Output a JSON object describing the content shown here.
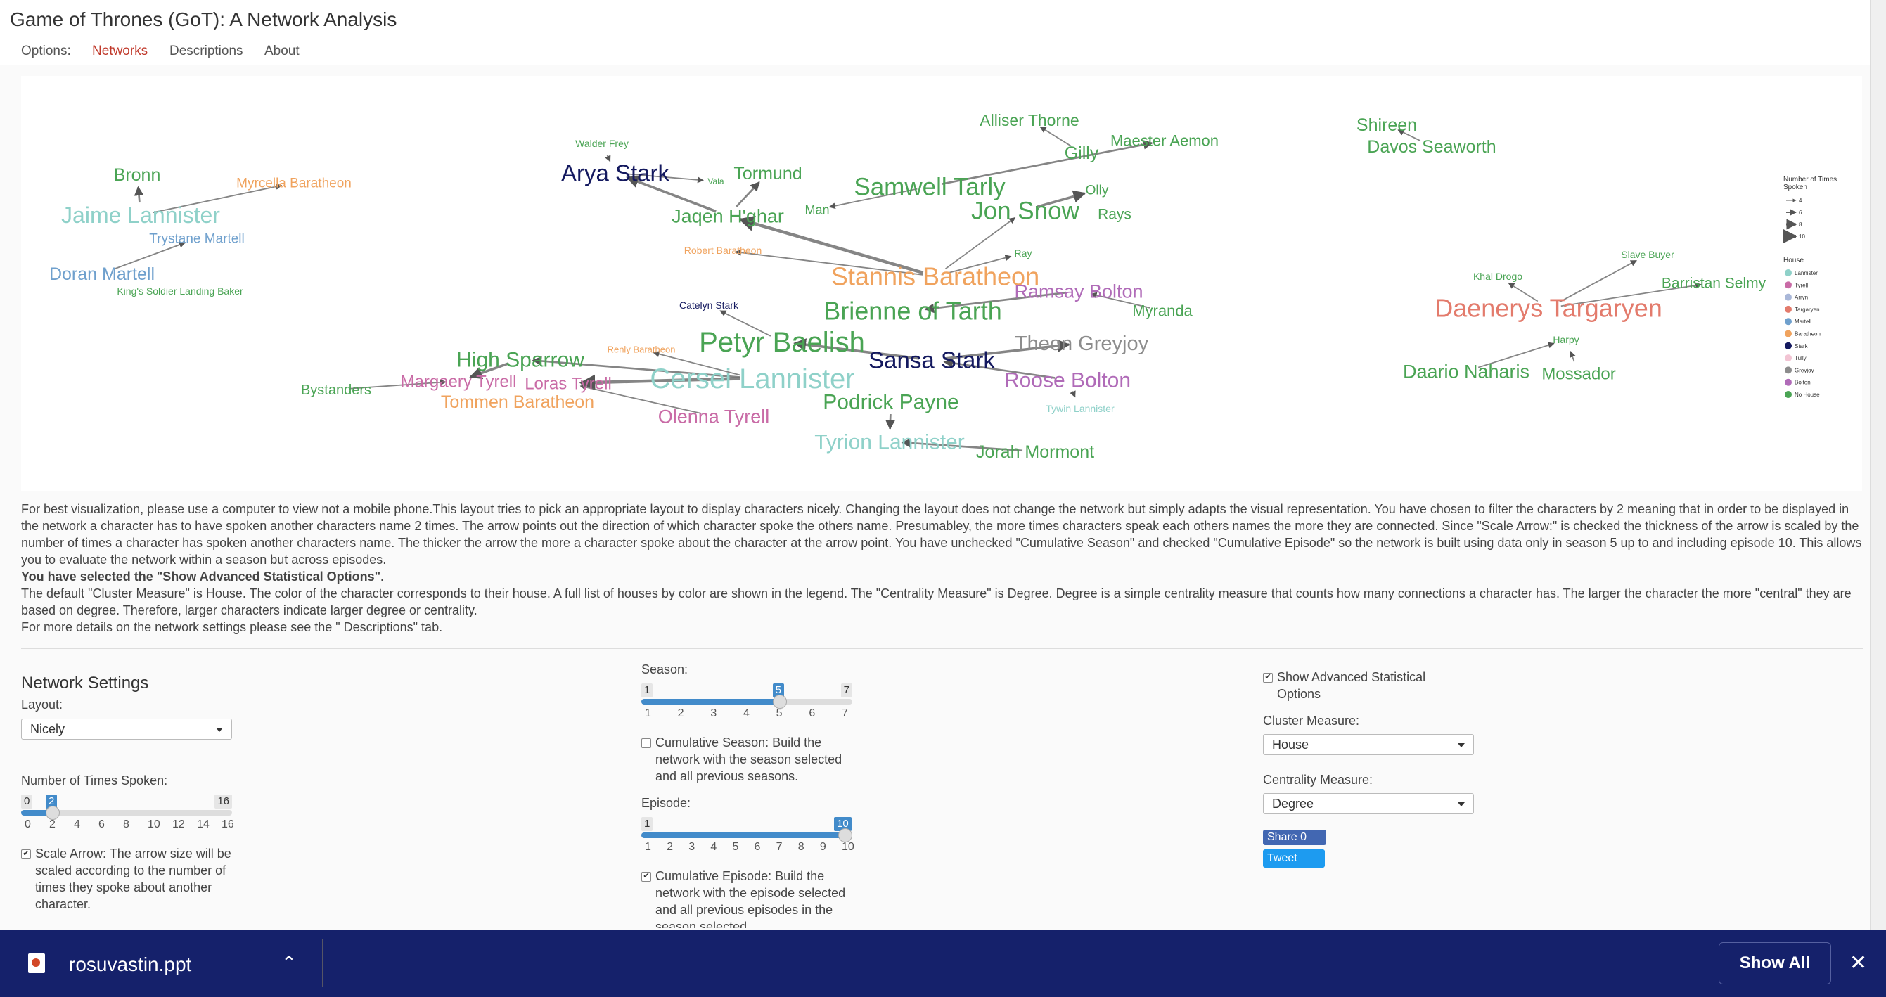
{
  "app_title": "Game of Thrones (GoT): A Network Analysis",
  "nav": {
    "options": "Options:",
    "networks": "Networks",
    "descriptions": "Descriptions",
    "about": "About"
  },
  "colors": {
    "active_nav": "#c0392b",
    "slider": "#428bca",
    "download_bar": "#15216b"
  },
  "network": {
    "legend": {
      "size_title_1": "Number of Times",
      "size_title_2": "Spoken",
      "sizes": [
        "4",
        "6",
        "8",
        "10"
      ],
      "house_title": "House",
      "houses": [
        {
          "name": "Lannister",
          "color": "#8fd1c9"
        },
        {
          "name": "Tyrell",
          "color": "#c96ba6"
        },
        {
          "name": "Arryn",
          "color": "#a9b7d8"
        },
        {
          "name": "Targaryen",
          "color": "#e37b6c"
        },
        {
          "name": "Martell",
          "color": "#6fa0cd"
        },
        {
          "name": "Baratheon",
          "color": "#f0a35e"
        },
        {
          "name": "Stark",
          "color": "#14195f"
        },
        {
          "name": "Tully",
          "color": "#f2c4d3"
        },
        {
          "name": "Greyjoy",
          "color": "#8c8c8c"
        },
        {
          "name": "Bolton",
          "color": "#b06bb8"
        },
        {
          "name": "No House",
          "color": "#4aa454"
        }
      ]
    },
    "nodes": [
      {
        "name": "Bronn",
        "house": "No House",
        "size": 25
      },
      {
        "name": "Myrcella Baratheon",
        "house": "Baratheon",
        "size": 19
      },
      {
        "name": "Jaime Lannister",
        "house": "Lannister",
        "size": 32
      },
      {
        "name": "Trystane Martell",
        "house": "Martell",
        "size": 19
      },
      {
        "name": "Doran Martell",
        "house": "Martell",
        "size": 25
      },
      {
        "name": "King's Soldier Landing Baker",
        "house": "No House",
        "size": 14
      },
      {
        "name": "Walder Frey",
        "house": "No House",
        "size": 14
      },
      {
        "name": "Arya Stark",
        "house": "Stark",
        "size": 33
      },
      {
        "name": "Vala",
        "house": "No House",
        "size": 12
      },
      {
        "name": "Tormund",
        "house": "No House",
        "size": 25
      },
      {
        "name": "Jaqen H'ghar",
        "house": "No House",
        "size": 27
      },
      {
        "name": "Man",
        "house": "No House",
        "size": 18
      },
      {
        "name": "Samwell Tarly",
        "house": "No House",
        "size": 35
      },
      {
        "name": "Alliser Thorne",
        "house": "No House",
        "size": 23
      },
      {
        "name": "Gilly",
        "house": "No House",
        "size": 25
      },
      {
        "name": "Maester Aemon",
        "house": "No House",
        "size": 22
      },
      {
        "name": "Olly",
        "house": "No House",
        "size": 19
      },
      {
        "name": "Jon Snow",
        "house": "No House",
        "size": 35
      },
      {
        "name": "Rays",
        "house": "No House",
        "size": 21
      },
      {
        "name": "Robert Baratheon",
        "house": "Baratheon",
        "size": 14
      },
      {
        "name": "Ray",
        "house": "No House",
        "size": 14
      },
      {
        "name": "Stannis Baratheon",
        "house": "Baratheon",
        "size": 36
      },
      {
        "name": "Ramsay Bolton",
        "house": "Bolton",
        "size": 27
      },
      {
        "name": "Myranda",
        "house": "No House",
        "size": 22
      },
      {
        "name": "Catelyn Stark",
        "house": "Stark",
        "size": 14
      },
      {
        "name": "Brienne of Tarth",
        "house": "No House",
        "size": 36
      },
      {
        "name": "Theon Greyjoy",
        "house": "Greyjoy",
        "size": 29
      },
      {
        "name": "Renly Baratheon",
        "house": "Baratheon",
        "size": 13
      },
      {
        "name": "Petyr Baelish",
        "house": "No House",
        "size": 40
      },
      {
        "name": "High Sparrow",
        "house": "No House",
        "size": 30
      },
      {
        "name": "Sansa Stark",
        "house": "Stark",
        "size": 33
      },
      {
        "name": "Bystanders",
        "house": "No House",
        "size": 20
      },
      {
        "name": "Margaery Tyrell",
        "house": "Tyrell",
        "size": 24
      },
      {
        "name": "Loras Tyrell",
        "house": "Tyrell",
        "size": 24
      },
      {
        "name": "Cersei Lannister",
        "house": "Lannister",
        "size": 40
      },
      {
        "name": "Roose Bolton",
        "house": "Bolton",
        "size": 30
      },
      {
        "name": "Tommen Baratheon",
        "house": "Baratheon",
        "size": 25
      },
      {
        "name": "Podrick Payne",
        "house": "No House",
        "size": 30
      },
      {
        "name": "Olenna Tyrell",
        "house": "Tyrell",
        "size": 27
      },
      {
        "name": "Tywin Lannister",
        "house": "Lannister",
        "size": 14
      },
      {
        "name": "Tyrion Lannister",
        "house": "Lannister",
        "size": 30
      },
      {
        "name": "Jorah Mormont",
        "house": "No House",
        "size": 25
      },
      {
        "name": "Shireen",
        "house": "No House",
        "size": 25
      },
      {
        "name": "Davos Seaworth",
        "house": "No House",
        "size": 25
      },
      {
        "name": "Slave Buyer",
        "house": "No House",
        "size": 14
      },
      {
        "name": "Khal Drogo",
        "house": "No House",
        "size": 14
      },
      {
        "name": "Barristan Selmy",
        "house": "No House",
        "size": 21
      },
      {
        "name": "Daenerys Targaryen",
        "house": "Targaryen",
        "size": 36
      },
      {
        "name": "Harpy",
        "house": "No House",
        "size": 14
      },
      {
        "name": "Daario Naharis",
        "house": "No House",
        "size": 27
      },
      {
        "name": "Mossador",
        "house": "No House",
        "size": 24
      }
    ],
    "edges": [
      {
        "from": "Jaime Lannister",
        "to": "Bronn",
        "w": 2
      },
      {
        "from": "Jaime Lannister",
        "to": "Myrcella Baratheon",
        "w": 1
      },
      {
        "from": "Doran Martell",
        "to": "Trystane Martell",
        "w": 1
      },
      {
        "from": "Walder Frey",
        "to": "Arya Stark",
        "w": 1
      },
      {
        "from": "Arya Stark",
        "to": "Vala",
        "w": 1
      },
      {
        "from": "Jaqen H'ghar",
        "to": "Arya Stark",
        "w": 3
      },
      {
        "from": "Jaqen H'ghar",
        "to": "Tormund",
        "w": 2
      },
      {
        "from": "Samwell Tarly",
        "to": "Man",
        "w": 1
      },
      {
        "from": "Gilly",
        "to": "Alliser Thorne",
        "w": 1
      },
      {
        "from": "Samwell Tarly",
        "to": "Maester Aemon",
        "w": 2
      },
      {
        "from": "Jon Snow",
        "to": "Olly",
        "w": 3
      },
      {
        "from": "Stannis Baratheon",
        "to": "Jon Snow",
        "w": 1
      },
      {
        "from": "Stannis Baratheon",
        "to": "Robert Baratheon",
        "w": 1
      },
      {
        "from": "Stannis Baratheon",
        "to": "Ray",
        "w": 1
      },
      {
        "from": "Stannis Baratheon",
        "to": "Jaqen H'ghar",
        "w": 4
      },
      {
        "from": "Ramsay Bolton",
        "to": "Brienne of Tarth",
        "w": 2
      },
      {
        "from": "Myranda",
        "to": "Ramsay Bolton",
        "w": 1
      },
      {
        "from": "Petyr Baelish",
        "to": "Catelyn Stark",
        "w": 1
      },
      {
        "from": "Sansa Stark",
        "to": "Theon Greyjoy",
        "w": 3
      },
      {
        "from": "Sansa Stark",
        "to": "Petyr Baelish",
        "w": 3
      },
      {
        "from": "Cersei Lannister",
        "to": "Renly Baratheon",
        "w": 1
      },
      {
        "from": "Cersei Lannister",
        "to": "High Sparrow",
        "w": 2
      },
      {
        "from": "High Sparrow",
        "to": "Margaery Tyrell",
        "w": 3
      },
      {
        "from": "Bystanders",
        "to": "Margaery Tyrell",
        "w": 1
      },
      {
        "from": "Cersei Lannister",
        "to": "Loras Tyrell",
        "w": 4
      },
      {
        "from": "Olenna Tyrell",
        "to": "Loras Tyrell",
        "w": 1
      },
      {
        "from": "Roose Bolton",
        "to": "Sansa Stark",
        "w": 2
      },
      {
        "from": "Roose Bolton",
        "to": "Tywin Lannister",
        "w": 1
      },
      {
        "from": "Podrick Payne",
        "to": "Tyrion Lannister",
        "w": 2
      },
      {
        "from": "Jorah Mormont",
        "to": "Tyrion Lannister",
        "w": 2
      },
      {
        "from": "Davos Seaworth",
        "to": "Shireen",
        "w": 1
      },
      {
        "from": "Daenerys Targaryen",
        "to": "Slave Buyer",
        "w": 1
      },
      {
        "from": "Daenerys Targaryen",
        "to": "Khal Drogo",
        "w": 1
      },
      {
        "from": "Daenerys Targaryen",
        "to": "Barristan Selmy",
        "w": 1
      },
      {
        "from": "Daario Naharis",
        "to": "Harpy",
        "w": 1
      },
      {
        "from": "Mossador",
        "to": "Harpy",
        "w": 1
      }
    ]
  },
  "description": {
    "p1": "For best visualization, please use a computer to view not a mobile phone.This layout tries to pick an appropriate layout to display characters nicely. Changing the layout does not change the network but simply adapts the visual representation. You have chosen to filter the characters by 2 meaning that in order to be displayed in the network a character has to have spoken another characters name 2 times. The arrow points out the direction of which character spoke the others name. Presumabley, the more times characters speak each others names the more they are connected. Since \"Scale Arrow:\" is checked the thickness of the arrow is scaled by the number of times a character has spoken another characters name. The thicker the arrow the more a character spoke about the character at the arrow point. You have unchecked \"Cumulative Season\" and checked \"Cumulative Episode\" so the network is built using data only in season 5 up to and including episode 10. This allows you to evaluate the network within a season but across episodes.",
    "p2": "You have selected the \"Show Advanced Statistical Options\".",
    "p3": "The default \"Cluster Measure\" is House. The color of the character corresponds to their house. A full list of houses by color are shown in the legend. The \"Centrality Measure\" is Degree. Degree is a simple centrality measure that counts how many connections a character has. The larger the character the more \"central\" they are based on degree. Therefore, larger characters indicate larger degree or centrality.",
    "p4": "For more details on the network settings please see the \" Descriptions\" tab."
  },
  "settings": {
    "heading": "Network Settings",
    "layout_label": "Layout:",
    "layout_value": "Nicely",
    "times_label": "Number of Times Spoken:",
    "times": {
      "min": "0",
      "max": "16",
      "value": "2",
      "fraction": 0.125,
      "ticks": [
        "0",
        "2",
        "4",
        "6",
        "8",
        "10",
        "12",
        "14",
        "16"
      ]
    },
    "scale_arrow_text": "Scale Arrow: The arrow size will be scaled according to the number of times they spoke about another character.",
    "season_label": "Season:",
    "season": {
      "min": "1",
      "max": "7",
      "value": "5",
      "fraction": 0.6667,
      "ticks": [
        "1",
        "2",
        "3",
        "4",
        "5",
        "6",
        "7"
      ]
    },
    "cum_season_text": "Cumulative Season: Build the network with the season selected and all previous seasons.",
    "episode_label": "Episode:",
    "episode": {
      "min": "1",
      "max": "10",
      "value": "10",
      "fraction": 1.0,
      "ticks": [
        "1",
        "2",
        "3",
        "4",
        "5",
        "6",
        "7",
        "8",
        "9",
        "10"
      ]
    },
    "cum_episode_text": "Cumulative Episode: Build the network with the episode selected and all previous episodes in the season selected",
    "advanced_text": "Show Advanced Statistical Options",
    "cluster_label": "Cluster Measure:",
    "cluster_value": "House",
    "centrality_label": "Centrality Measure:",
    "centrality_value": "Degree",
    "share_label": "Share 0",
    "tweet_label": "Tweet",
    "check_mark": "✔"
  },
  "download": {
    "file_name": "rosuvastin.ppt",
    "show_all": "Show All",
    "close": "✕",
    "chevron": "⌃"
  }
}
